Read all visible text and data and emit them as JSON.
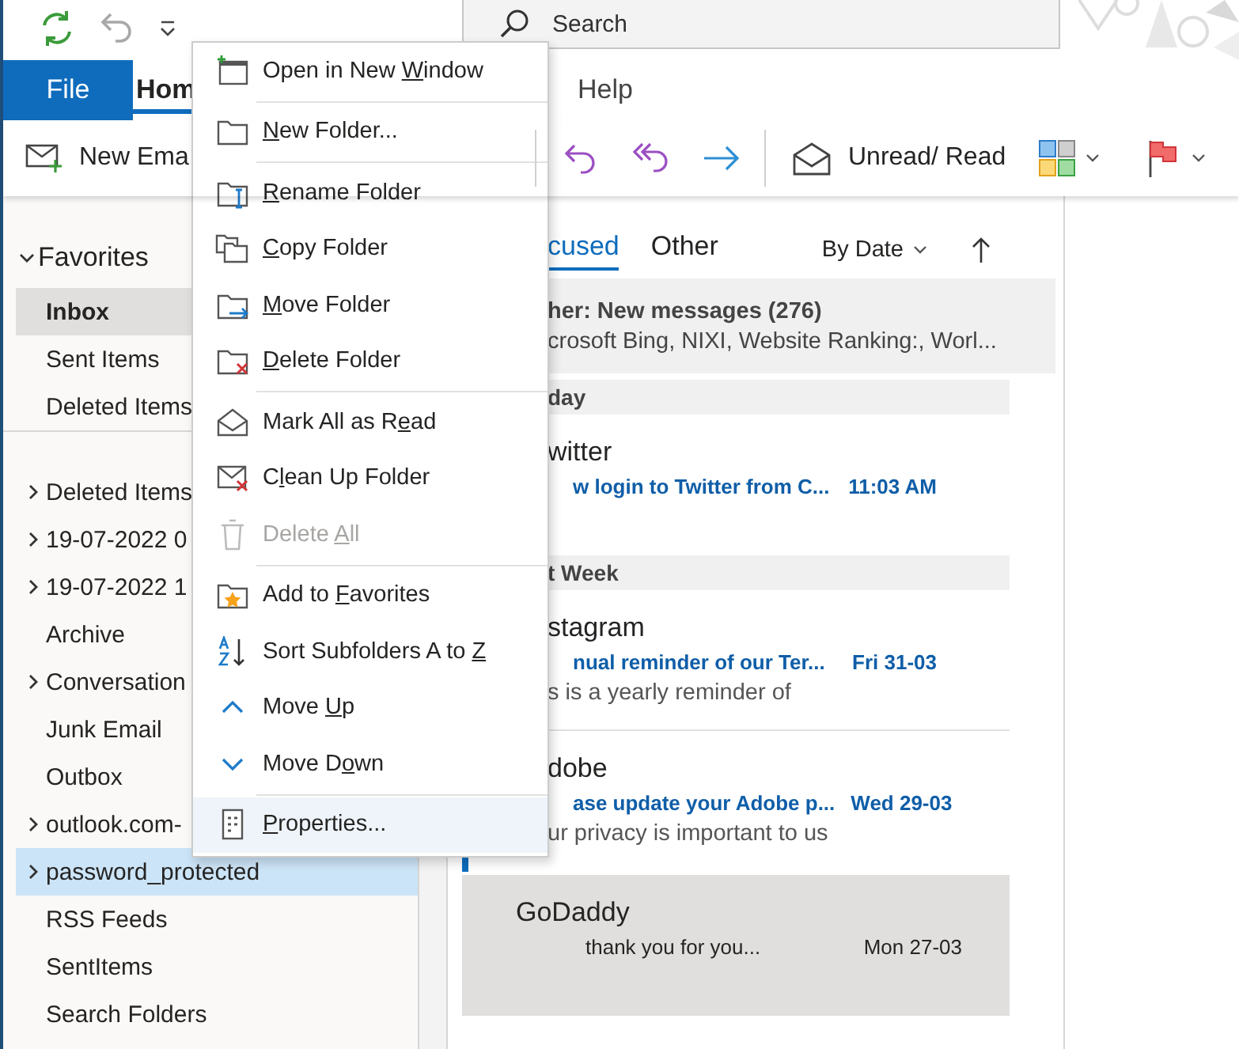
{
  "search": {
    "placeholder": "Search"
  },
  "ribbon_tabs": [
    {
      "label": "File",
      "kind": "file",
      "selected": false
    },
    {
      "label": "Hom",
      "kind": "tab",
      "selected": true
    },
    {
      "label": "Help",
      "kind": "tab",
      "selected": false
    }
  ],
  "commands": {
    "new_email": "New Ema",
    "unread_read": "Unread/ Read"
  },
  "sidebar": {
    "favorites": {
      "label": "Favorites",
      "expanded": true,
      "items": [
        {
          "label": "Inbox",
          "selected": true
        },
        {
          "label": "Sent Items",
          "selected": false
        },
        {
          "label": "Deleted Items",
          "selected": false
        }
      ]
    },
    "folders": [
      {
        "label": "Deleted Items",
        "expandable": true,
        "selected": false
      },
      {
        "label": "19-07-2022 0",
        "expandable": true,
        "selected": false
      },
      {
        "label": "19-07-2022 1",
        "expandable": true,
        "selected": false
      },
      {
        "label": "Archive",
        "expandable": false,
        "selected": false
      },
      {
        "label": "Conversation",
        "expandable": true,
        "selected": false
      },
      {
        "label": "Junk Email",
        "expandable": false,
        "selected": false
      },
      {
        "label": "Outbox",
        "expandable": false,
        "selected": false
      },
      {
        "label": "outlook.com-",
        "expandable": true,
        "selected": false
      },
      {
        "label": "password_protected",
        "expandable": true,
        "selected": true
      },
      {
        "label": "RSS Feeds",
        "expandable": false,
        "selected": false
      },
      {
        "label": "SentItems",
        "expandable": false,
        "selected": false
      },
      {
        "label": "Search Folders",
        "expandable": false,
        "selected": false
      }
    ]
  },
  "mail_list": {
    "tabs": [
      {
        "label": "cused",
        "selected": true
      },
      {
        "label": "Other",
        "selected": false
      }
    ],
    "sort": "By Date",
    "banner": {
      "title": "her: New messages (276)",
      "senders": "crosoft Bing, NIXI, Website Ranking:, Worl..."
    },
    "entries": [
      {
        "kind": "header",
        "label": "day"
      },
      {
        "kind": "message",
        "sender": "witter",
        "subject": "w login to Twitter from C...",
        "date": "11:03 AM",
        "unread": true,
        "selected": false
      },
      {
        "kind": "header",
        "label": "t Week"
      },
      {
        "kind": "message",
        "sender": "stagram",
        "subject": "nual reminder of our Ter...",
        "date": "Fri 31-03",
        "preview": "s is a yearly reminder of",
        "unread": true,
        "selected": false
      },
      {
        "kind": "message",
        "sender": "dobe",
        "subject": "ase update your Adobe p...",
        "date": "Wed 29-03",
        "preview": "ur privacy is important to us",
        "unread": true,
        "selected": false
      },
      {
        "kind": "message",
        "sender": "GoDaddy",
        "subject": "thank you for you...",
        "date": "Mon 27-03",
        "unread": false,
        "selected": true
      }
    ]
  },
  "context_menu": {
    "items": [
      {
        "label": {
          "before": "Open in New ",
          "key": "W",
          "after": "indow"
        },
        "disabled": false,
        "hovered": false,
        "separator_after": true
      },
      {
        "label": {
          "key": "N",
          "after": "ew Folder..."
        },
        "disabled": false,
        "hovered": false,
        "separator_after": true
      },
      {
        "label": {
          "key": "R",
          "after": "ename Folder"
        },
        "disabled": false,
        "hovered": false,
        "separator_after": false
      },
      {
        "label": {
          "key": "C",
          "after": "opy Folder"
        },
        "disabled": false,
        "hovered": false,
        "separator_after": false
      },
      {
        "label": {
          "key": "M",
          "after": "ove Folder"
        },
        "disabled": false,
        "hovered": false,
        "separator_after": false
      },
      {
        "label": {
          "key": "D",
          "after": "elete Folder"
        },
        "disabled": false,
        "hovered": false,
        "separator_after": true
      },
      {
        "label": {
          "before": "Mark All as R",
          "key": "e",
          "after": "ad"
        },
        "disabled": false,
        "hovered": false,
        "separator_after": false
      },
      {
        "label": {
          "before": "C",
          "key": "l",
          "after": "ean Up Folder"
        },
        "disabled": false,
        "hovered": false,
        "separator_after": false
      },
      {
        "label": {
          "before": "Delete ",
          "key": "A",
          "after": "ll"
        },
        "disabled": true,
        "hovered": false,
        "separator_after": true
      },
      {
        "label": {
          "before": "Add to ",
          "key": "F",
          "after": "avorites"
        },
        "disabled": false,
        "hovered": false,
        "separator_after": false
      },
      {
        "label": {
          "before": "Sort Subfolders A to ",
          "key": "Z"
        },
        "disabled": false,
        "hovered": false,
        "separator_after": false
      },
      {
        "label": {
          "before": "Move ",
          "key": "U",
          "after": "p"
        },
        "disabled": false,
        "hovered": false,
        "separator_after": false
      },
      {
        "label": {
          "before": "Move D",
          "key": "o",
          "after": "wn"
        },
        "disabled": false,
        "hovered": false,
        "separator_after": true
      },
      {
        "label": {
          "key": "P",
          "after": "roperties..."
        },
        "disabled": false,
        "hovered": true,
        "separator_after": false
      }
    ]
  }
}
